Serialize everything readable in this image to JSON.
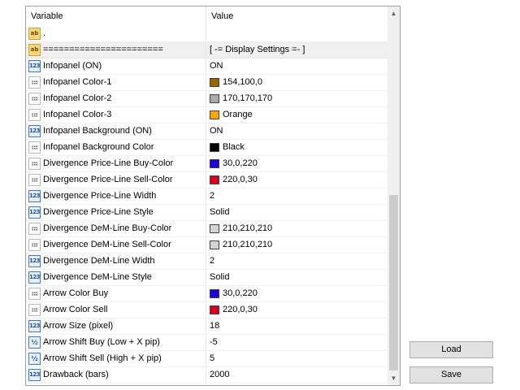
{
  "header": {
    "variable": "Variable",
    "value": "Value"
  },
  "rows": [
    {
      "icon": "ab",
      "name": ".",
      "value": ""
    },
    {
      "icon": "ab",
      "name": "=======================",
      "value": "[ -= Display Settings =- ]",
      "separator": true
    },
    {
      "icon": "123",
      "name": "Infopanel (ON)",
      "value": "ON"
    },
    {
      "icon": "color",
      "name": "Infopanel Color-1",
      "value": "154,100,0",
      "swatch": "#9a6400"
    },
    {
      "icon": "color",
      "name": "Infopanel Color-2",
      "value": "170,170,170",
      "swatch": "#aaaaaa"
    },
    {
      "icon": "color",
      "name": "Infopanel Color-3",
      "value": "Orange",
      "swatch": "#ffa500"
    },
    {
      "icon": "123",
      "name": "Infopanel Background (ON)",
      "value": "ON"
    },
    {
      "icon": "color",
      "name": "Infopanel Background Color",
      "value": "Black",
      "swatch": "#000000"
    },
    {
      "icon": "color",
      "name": "Divergence Price-Line Buy-Color",
      "value": "30,0,220",
      "swatch": "#1e00dc"
    },
    {
      "icon": "color",
      "name": "Divergence Price-Line Sell-Color",
      "value": "220,0,30",
      "swatch": "#dc001e"
    },
    {
      "icon": "123",
      "name": "Divergence Price-Line Width",
      "value": "2"
    },
    {
      "icon": "123",
      "name": "Divergence Price-Line Style",
      "value": "Solid"
    },
    {
      "icon": "color",
      "name": "Divergence DeM-Line Buy-Color",
      "value": "210,210,210",
      "swatch": "#d2d2d2"
    },
    {
      "icon": "color",
      "name": "Divergence DeM-Line Sell-Color",
      "value": "210,210,210",
      "swatch": "#d2d2d2"
    },
    {
      "icon": "123",
      "name": "Divergence DeM-Line Width",
      "value": "2"
    },
    {
      "icon": "123",
      "name": "Divergence DeM-Line Style",
      "value": "Solid"
    },
    {
      "icon": "color",
      "name": "Arrow Color Buy",
      "value": "30,0,220",
      "swatch": "#1e00dc"
    },
    {
      "icon": "color",
      "name": "Arrow Color Sell",
      "value": "220,0,30",
      "swatch": "#dc001e"
    },
    {
      "icon": "123",
      "name": "Arrow Size (pixel)",
      "value": "18"
    },
    {
      "icon": "frac",
      "name": "Arrow Shift Buy (Low + X pip)",
      "value": "-5"
    },
    {
      "icon": "frac",
      "name": "Arrow Shift Sell (High + X pip)",
      "value": "5"
    },
    {
      "icon": "123",
      "name": "Drawback (bars)",
      "value": "2000"
    }
  ],
  "icon_glyphs": {
    "ab": "ab",
    "123": "123",
    "frac": "½"
  },
  "buttons": {
    "load": "Load",
    "save": "Save"
  }
}
